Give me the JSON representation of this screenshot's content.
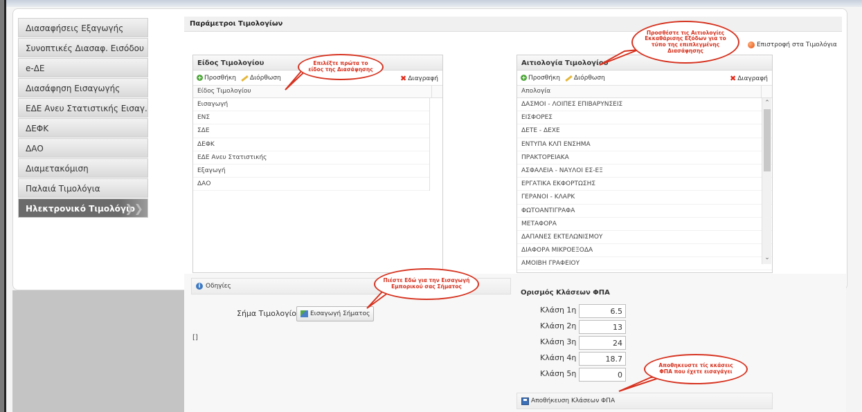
{
  "menu": {
    "items": [
      {
        "label": "Διασαφήσεις Εξαγωγής"
      },
      {
        "label": "Συνοπτικές Διασαφ. Εισόδου"
      },
      {
        "label": "e-ΔΕ"
      },
      {
        "label": "Διασάφηση Εισαγωγής"
      },
      {
        "label": "ΕΔΕ Ανευ Στατιστικής Εισαγ."
      },
      {
        "label": "ΔΕΦΚ"
      },
      {
        "label": "ΔΑΟ"
      },
      {
        "label": "Διαμετακόμιση"
      },
      {
        "label": "Παλαιά Τιμολόγια"
      },
      {
        "label": "Ηλεκτρονικό Τιμολόγιο"
      }
    ],
    "active_index": 9
  },
  "header": {
    "title": "Παράμετροι Τιμολογίων",
    "return_link": "Επιστροφή στα Τιμολόγια"
  },
  "invoice_type": {
    "title": "Είδος Τιμολογίου",
    "add": "Προσθήκη",
    "edit": "Διόρθωση",
    "delete": "Διαγραφή",
    "column": "Είδος Τιμολογίου",
    "rows": [
      "Εισαγωγή",
      "ΕΝΣ",
      "ΣΔΕ",
      "ΔΕΦΚ",
      "ΕΔΕ Ανευ Στατιστικής",
      "Εξαγωγή",
      "ΔΑΟ"
    ]
  },
  "reason": {
    "title": "Αιτιολογία Τιμολογίου",
    "add": "Προσθήκη",
    "edit": "Διόρθωση",
    "delete": "Διαγραφή",
    "column": "Απολογία",
    "rows": [
      "ΔΑΣΜΟΙ - ΛΟΙΠΕΣ ΕΠΙΒΑΡΥΝΣΕΙΣ",
      "ΕΙΣΦΟΡΕΣ",
      "ΔΕΤΕ - ΔΕΧΕ",
      "ΕΝΤΥΠΑ ΚΛΠ ΕΝΣΗΜΑ",
      "ΠΡΑΚΤΟΡΕΙΑΚΑ",
      "ΑΣΦΑΛΕΙΑ - ΝΑΥΛΟΙ ΕΣ-ΕΞ",
      "ΕΡΓΑΤΙΚΑ ΕΚΦΟΡΤΩΣΗΣ",
      "ΓΕΡΑΝΟΙ - ΚΛΑΡΚ",
      "ΦΩΤΟΑΝΤΙΓΡΑΦΑ",
      "ΜΕΤΑΦΟΡΑ",
      "ΔΑΠΑΝΕΣ ΕΚΤΕΛΩΝΙΣΜΟΥ",
      "ΔΙΑΦΟΡΑ ΜΙΚΡΟΕΞΟΔΑ",
      "ΑΜΟΙΒΗ ΓΡΑΦΕΙΟΥ"
    ]
  },
  "instructions": {
    "label": "Οδηγίες",
    "stamp_label": "Σήμα Τιμολογίου",
    "stamp_button": "Εισαγωγή Σήματος",
    "placeholder_text": "[]"
  },
  "vat": {
    "title": "Ορισμός Κλάσεων ΦΠΑ",
    "classes": [
      {
        "label": "Κλάση 1η",
        "value": "6.5"
      },
      {
        "label": "Κλάση 2η",
        "value": "13"
      },
      {
        "label": "Κλάση 3η",
        "value": "24"
      },
      {
        "label": "Κλάση 4η",
        "value": "18.7"
      },
      {
        "label": "Κλάση 5η",
        "value": "0"
      }
    ],
    "save_button": "Αποθήκευση Κλάσεων ΦΠΑ"
  },
  "callouts": {
    "select_type": "Επιλέξτε πρώτα το είδος της Διασάφησης",
    "add_reasons": "Προσθέστε τις Αιτιολογίες Εκκαθάρισης Εξόδων για το τύπο της επιπλεγμένης Διασάφησης",
    "insert_stamp": "Πιέστε Εδώ για την Εισαγωγή Εμπορικού σας Σήματος",
    "save_vat": "Αποθηκευστε τίς κκάσεις ΦΠΑ που έχετε εισαγάγει"
  },
  "colors": {
    "callout": "#d6321f",
    "active_menu": "#6b6b6b"
  }
}
